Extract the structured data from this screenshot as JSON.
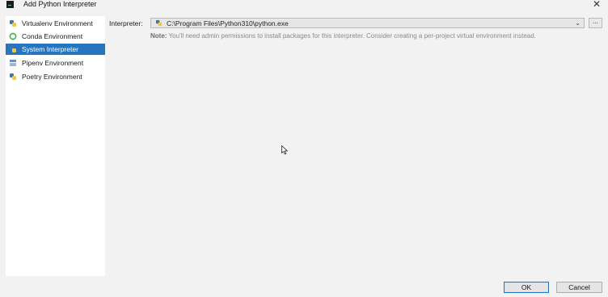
{
  "window": {
    "title": "Add Python Interpreter"
  },
  "sidebar": {
    "items": [
      {
        "label": "Virtualenv Environment",
        "icon": "python-icon",
        "selected": false
      },
      {
        "label": "Conda Environment",
        "icon": "conda-icon",
        "selected": false
      },
      {
        "label": "System Interpreter",
        "icon": "python-icon",
        "selected": true
      },
      {
        "label": "Pipenv Environment",
        "icon": "pipenv-icon",
        "selected": false
      },
      {
        "label": "Poetry Environment",
        "icon": "python-icon",
        "selected": false
      }
    ]
  },
  "main": {
    "interpreter_label": "Interpreter:",
    "interpreter_value": "C:\\Program Files\\Python310\\python.exe",
    "browse_label": "...",
    "note_bold": "Note:",
    "note_text": " You'll need admin permissions to install packages for this interpreter. Consider creating a per-project virtual environment instead."
  },
  "buttons": {
    "ok": "OK",
    "cancel": "Cancel"
  },
  "colors": {
    "selection": "#2675bf",
    "background": "#f2f2f2",
    "panel": "#ffffff"
  }
}
